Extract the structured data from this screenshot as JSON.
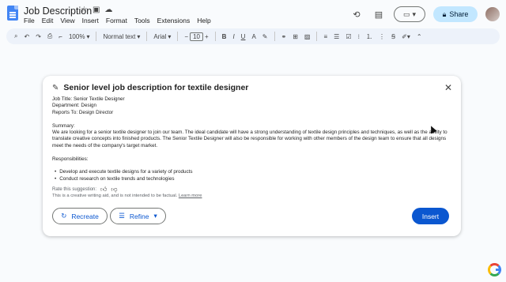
{
  "app": {
    "doc_title": "Job Description",
    "menu": [
      "File",
      "Edit",
      "View",
      "Insert",
      "Format",
      "Tools",
      "Extensions",
      "Help"
    ],
    "share_label": "Share"
  },
  "toolbar": {
    "zoom": "100%",
    "style": "Normal text",
    "font": "Arial",
    "font_size": "10"
  },
  "card": {
    "title": "Senior level job description for textile designer",
    "lines": [
      "Job Title: Senior Textile Designer",
      "Department: Design",
      "Reports To: Design Director"
    ],
    "summary_heading": "Summary:",
    "summary_text": "We are looking for a senior textile designer to join our team. The ideal candidate will have a strong understanding of textile design principles and techniques, as well as the ability to translate creative concepts into finished products. The Senior Textile Designer will also be responsible for working with other members of the design team to ensure that all designs meet the needs of the company's target market.",
    "responsibilities_heading": "Responsibilities:",
    "bullets": [
      "Develop and execute textile designs for a variety of products",
      "Conduct research on textile trends and technologies"
    ],
    "rate_label": "Rate this suggestion:",
    "disclaimer": "This is a creative writing aid, and is not intended to be factual.",
    "learn_more": "Learn more",
    "recreate_label": "Recreate",
    "refine_label": "Refine",
    "insert_label": "Insert"
  }
}
